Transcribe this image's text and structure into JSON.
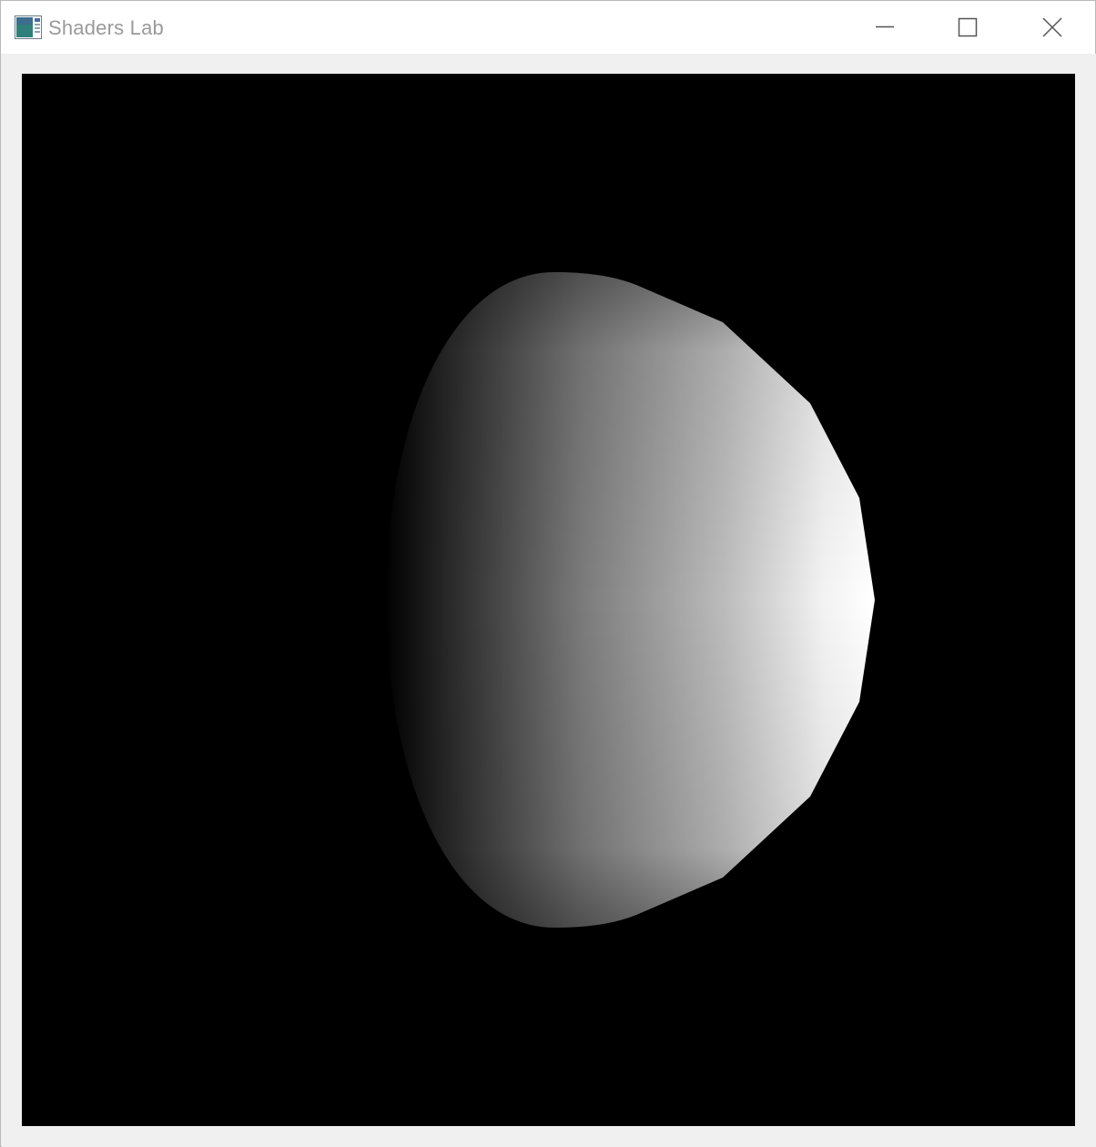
{
  "window": {
    "title": "Shaders Lab",
    "app_icon": "application-window-icon",
    "controls": {
      "minimize_icon": "minimize-icon",
      "maximize_icon": "maximize-icon",
      "close_icon": "close-icon"
    }
  },
  "viewport": {
    "background_color": "#000000",
    "object": "lit-sphere",
    "light_side": "right",
    "shade_dark_color": "#000000",
    "shade_light_color": "#ffffff"
  }
}
